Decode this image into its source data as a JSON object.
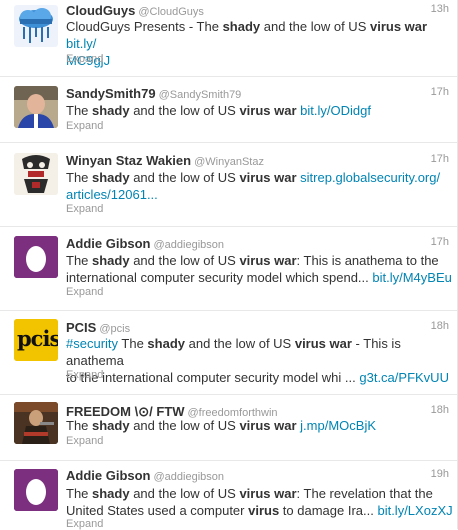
{
  "tweets": [
    {
      "name": "CloudGuys",
      "handle": "@CloudGuys",
      "time": "13h",
      "avatar_icon": "cloud-logo-icon",
      "line1_pre": "CloudGuys Presents - The ",
      "shady": "shady",
      "mid": " and the low of US ",
      "virus_war": "virus war",
      "line1_post": " ",
      "link": "bit.ly/",
      "line2_link": "MC9gjJ",
      "expand": "Expand"
    },
    {
      "name": "SandySmith79",
      "handle": "@SandySmith79",
      "time": "17h",
      "avatar_icon": "person-photo-icon",
      "pre": "The ",
      "shady": "shady",
      "mid": " and the low of US ",
      "virus_war": "virus war",
      "post": " ",
      "link": "bit.ly/ODidgf",
      "expand": "Expand"
    },
    {
      "name": "Winyan Staz Wakien",
      "handle": "@WinyanStaz",
      "time": "17h",
      "avatar_icon": "totem-art-icon",
      "pre": "The ",
      "shady": "shady",
      "mid": " and the low of US ",
      "virus_war": "virus war",
      "post": " ",
      "link": "sitrep.globalsecurity.org/",
      "line2_link": "articles/12061...",
      "expand": "Expand"
    },
    {
      "name": "Addie Gibson",
      "handle": "@addiegibson",
      "time": "17h",
      "avatar_icon": "default-egg-icon",
      "pre": "The ",
      "shady": "shady",
      "mid": " and the low of US ",
      "virus_war": "virus war",
      "post": ": This is anathema to the",
      "line2": "international computer security model which spend... ",
      "link": "bit.ly/M4yBEu",
      "expand": "Expand"
    },
    {
      "name": "PCIS",
      "handle": "@pcis",
      "time": "18h",
      "avatar_icon": "pcis-logo-icon",
      "logo_text": "pcis",
      "hashtag": "#security",
      "pre": " The ",
      "shady": "shady",
      "mid": " and the low of US ",
      "virus_war": "virus war",
      "post": " - This is anathema",
      "line2": "to the international computer security model whi ... ",
      "link": "g3t.ca/PFKvUU",
      "expand": "Expand"
    },
    {
      "name": "FREEDOM \\⊙/ FTW",
      "handle": "@freedomforthwin",
      "time": "18h",
      "avatar_icon": "soldier-photo-icon",
      "pre": "The ",
      "shady": "shady",
      "mid": " and the low of US ",
      "virus_war": "virus war",
      "post": " ",
      "link": "j.mp/MOcBjK",
      "expand": "Expand"
    },
    {
      "name": "Addie Gibson",
      "handle": "@addiegibson",
      "time": "19h",
      "avatar_icon": "default-egg-icon",
      "pre": "The ",
      "shady": "shady",
      "mid": " and the low of US ",
      "virus_war": "virus war",
      "post": ": The revelation that the",
      "line2_pre": "United States used a computer ",
      "virus": "virus",
      "line2_post": " to damage Ira... ",
      "link": "bit.ly/LXozXJ",
      "expand": "Expand"
    }
  ],
  "colors": {
    "link": "#0084b4",
    "text": "#333333",
    "meta": "#999999",
    "egg_bg": "#7b2f7e",
    "pcis_bg": "#f2c400"
  }
}
